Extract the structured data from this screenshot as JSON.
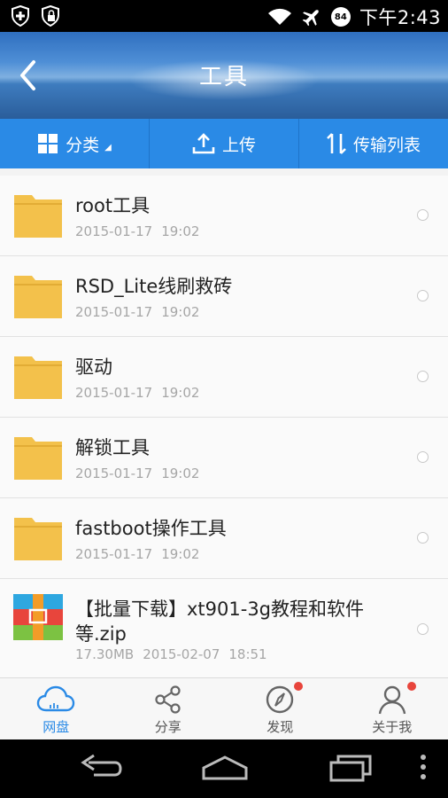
{
  "status_bar": {
    "time": "下午2:43",
    "battery_level": "84",
    "icons": [
      "shield-icon",
      "shield-lock-icon",
      "wifi-icon",
      "airplane-icon",
      "battery-icon"
    ]
  },
  "header": {
    "title": "工具",
    "back_icon": "chevron-left-icon"
  },
  "toolbar": {
    "category_label": "分类",
    "upload_label": "上传",
    "transfer_label": "传输列表"
  },
  "files": [
    {
      "name": "root工具",
      "date": "2015-01-17",
      "time": "19:02",
      "type": "folder"
    },
    {
      "name": "RSD_Lite线刷救砖",
      "date": "2015-01-17",
      "time": "19:02",
      "type": "folder"
    },
    {
      "name": "驱动",
      "date": "2015-01-17",
      "time": "19:02",
      "type": "folder"
    },
    {
      "name": "解锁工具",
      "date": "2015-01-17",
      "time": "19:02",
      "type": "folder"
    },
    {
      "name": "fastboot操作工具",
      "date": "2015-01-17",
      "time": "19:02",
      "type": "folder"
    },
    {
      "name": "【批量下载】xt901-3g教程和软件等.zip",
      "size": "17.30MB",
      "date": "2015-02-07",
      "time": "18:51",
      "type": "zip"
    }
  ],
  "tabs": [
    {
      "label": "网盘",
      "icon": "cloud-icon",
      "active": true,
      "badge": false
    },
    {
      "label": "分享",
      "icon": "share-icon",
      "active": false,
      "badge": false
    },
    {
      "label": "发现",
      "icon": "compass-icon",
      "active": false,
      "badge": true
    },
    {
      "label": "关于我",
      "icon": "user-icon",
      "active": false,
      "badge": true
    }
  ],
  "colors": {
    "accent": "#2a8ae6",
    "folder": "#f3c14b",
    "badge": "#e8453c"
  }
}
